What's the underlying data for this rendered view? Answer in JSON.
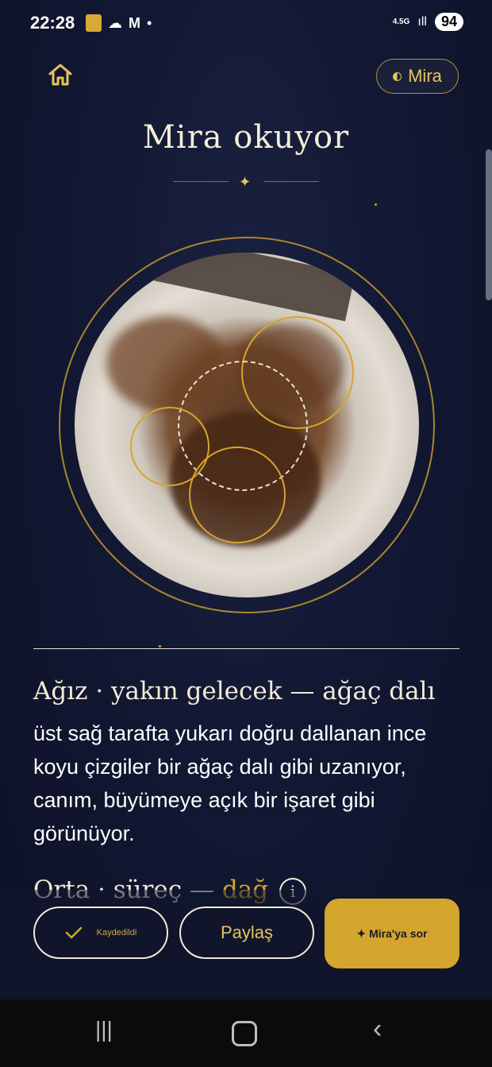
{
  "status_bar": {
    "time": "22:28",
    "icons_left": [
      "notification-icon",
      "cloud-icon",
      "gmail-icon",
      "dot"
    ],
    "network": "4.5G",
    "battery": "94"
  },
  "header": {
    "mira_label": "Mira",
    "title": "Mira okuyor"
  },
  "reading": {
    "section_title": "Ağız · yakın gelecek — ağaç dalı",
    "body": "üst sağ tarafta yukarı doğru dallanan ince koyu çizgiler bir ağaç dalı gibi uzanıyor, canım, büyümeye açık bir işaret gibi görünüyor.",
    "next_title_prefix": "Orta · süreç — ",
    "next_title_highlight": "dağ",
    "info_label": "i"
  },
  "actions": {
    "saved_label": "Kaydedildi",
    "share_label": "Paylaş",
    "ask_label": "✦ Mira'ya sor"
  },
  "colors": {
    "accent": "#d4a52c",
    "background": "#121833"
  }
}
